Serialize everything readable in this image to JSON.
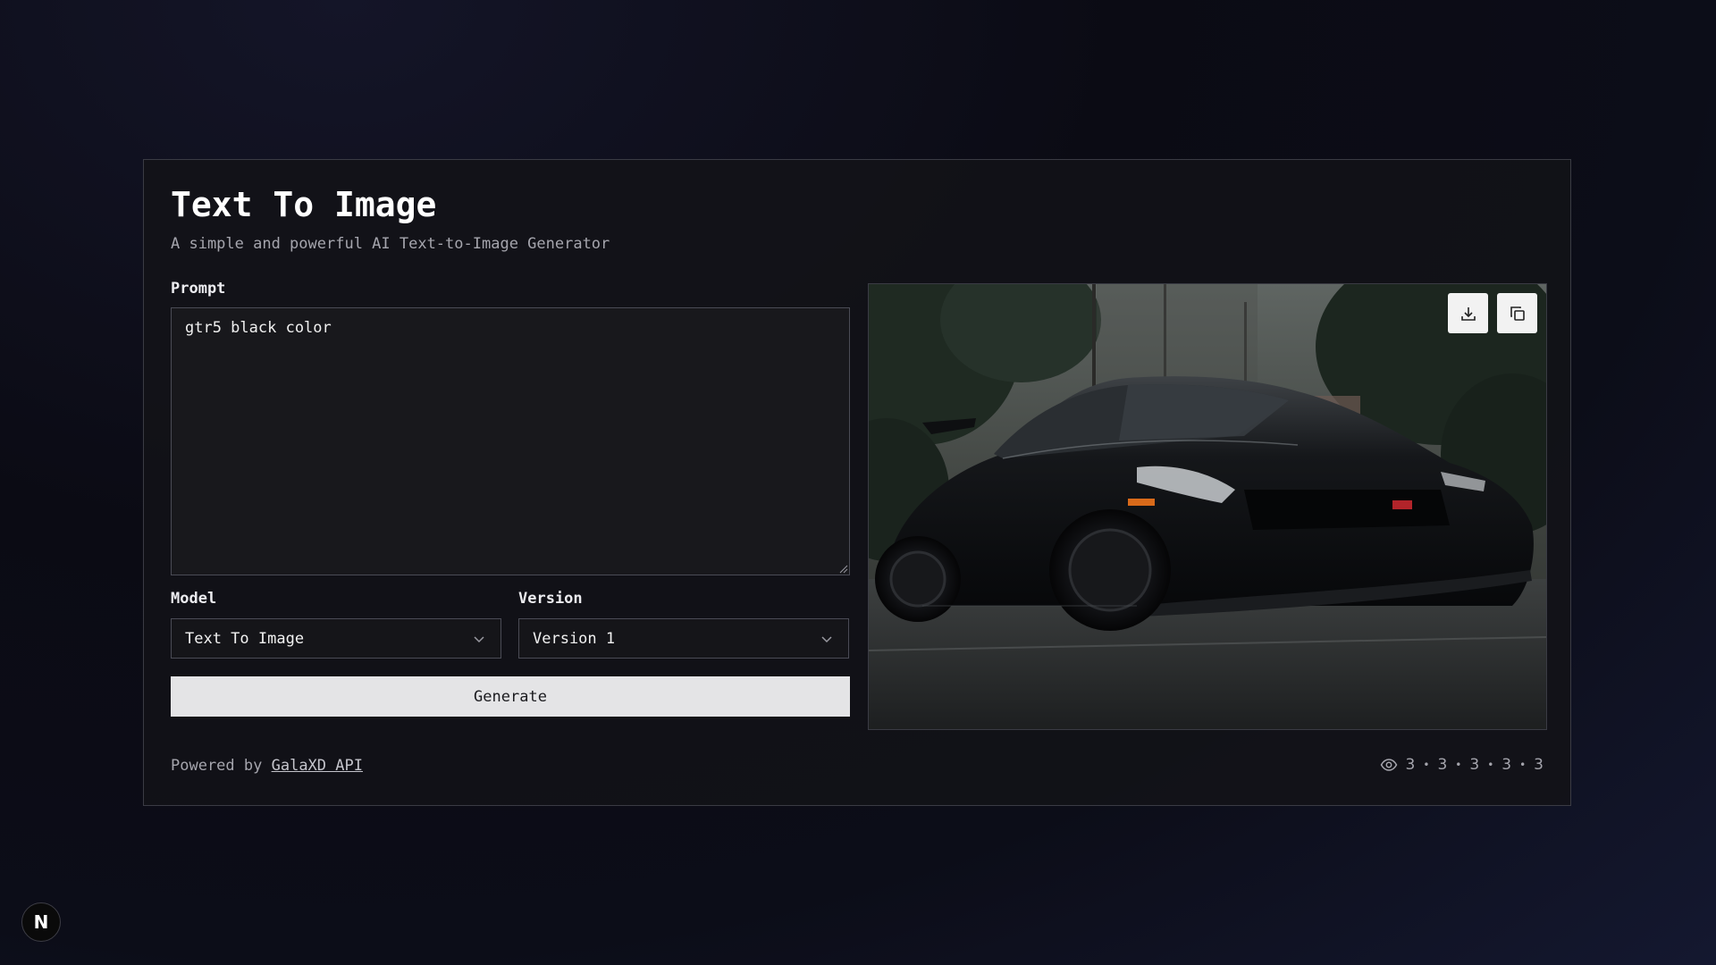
{
  "app": {
    "title": "Text To Image",
    "subtitle": "A simple and powerful AI Text-to-Image Generator"
  },
  "form": {
    "prompt_label": "Prompt",
    "prompt_value": "gtr5 black color",
    "model_label": "Model",
    "model_selected": "Text To Image",
    "version_label": "Version",
    "version_selected": "Version 1",
    "generate_label": "Generate"
  },
  "preview": {
    "download_icon": "download-icon",
    "copy_icon": "copy-icon"
  },
  "footer": {
    "powered_prefix": "Powered by",
    "powered_link": "GalaXD API",
    "stats": [
      "3",
      "3",
      "3",
      "3",
      "3"
    ],
    "stats_icon": "eye-icon",
    "separator": "•"
  },
  "badge": {
    "letter": "N"
  },
  "colors": {
    "background": "#0d0d16",
    "card_border": "#3a3b44",
    "button_bg": "#e4e4e6"
  }
}
